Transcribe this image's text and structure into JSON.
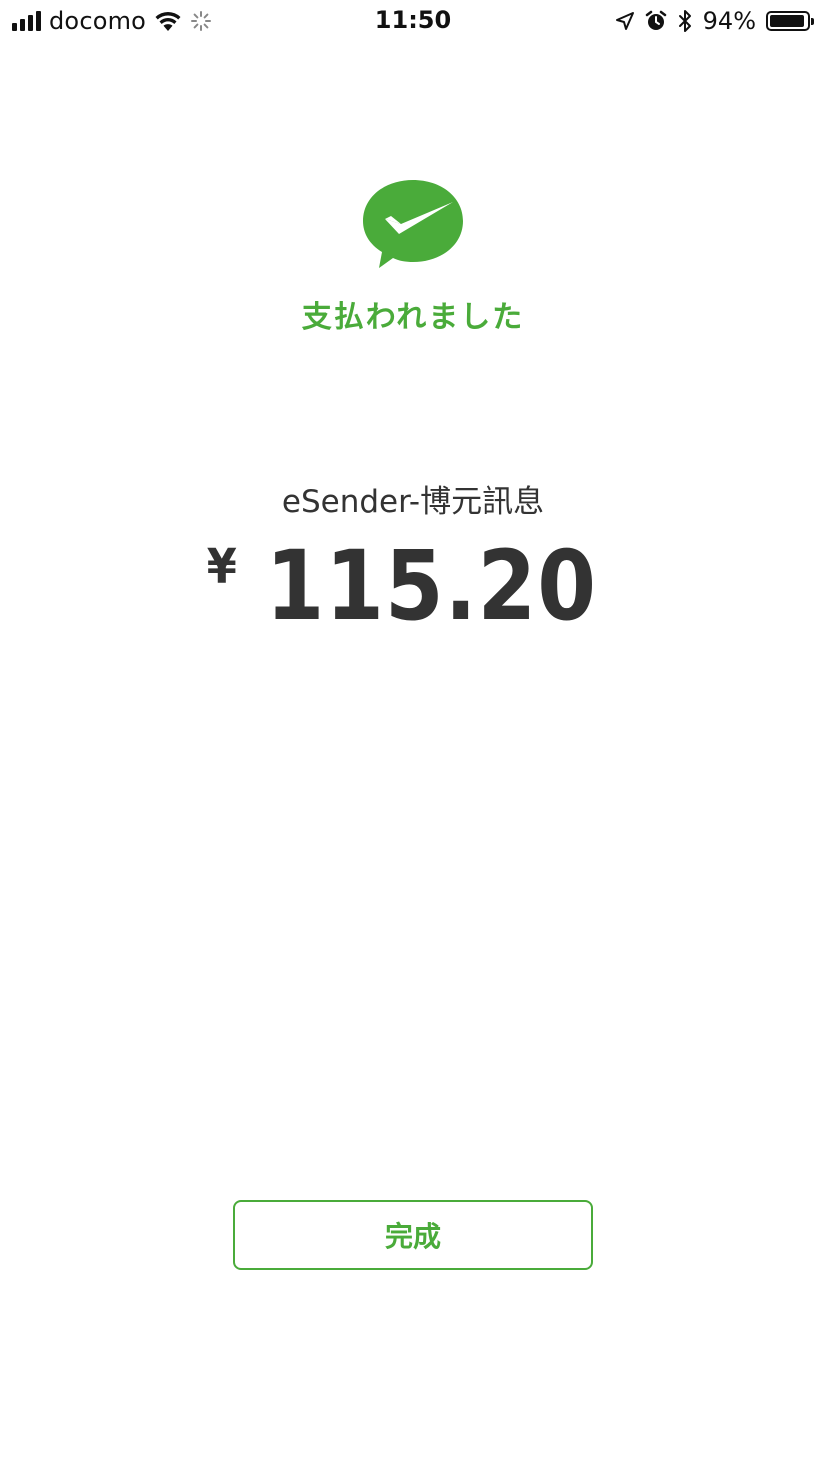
{
  "status_bar": {
    "carrier": "docomo",
    "time": "11:50",
    "battery_percent": "94%",
    "battery_level": 0.94,
    "icons": [
      "signal-icon",
      "wifi-icon",
      "activity-spinner-icon",
      "location-arrow-icon",
      "alarm-icon",
      "bluetooth-icon",
      "battery-icon"
    ]
  },
  "payment": {
    "logo_icon": "wechat-pay-check-bubble-icon",
    "status_text": "支払われました",
    "merchant": "eSender-博元訊息",
    "currency_symbol": "¥",
    "amount": "115.20"
  },
  "actions": {
    "done_label": "完成"
  },
  "colors": {
    "accent": "#4aab3a",
    "text": "#333333"
  }
}
